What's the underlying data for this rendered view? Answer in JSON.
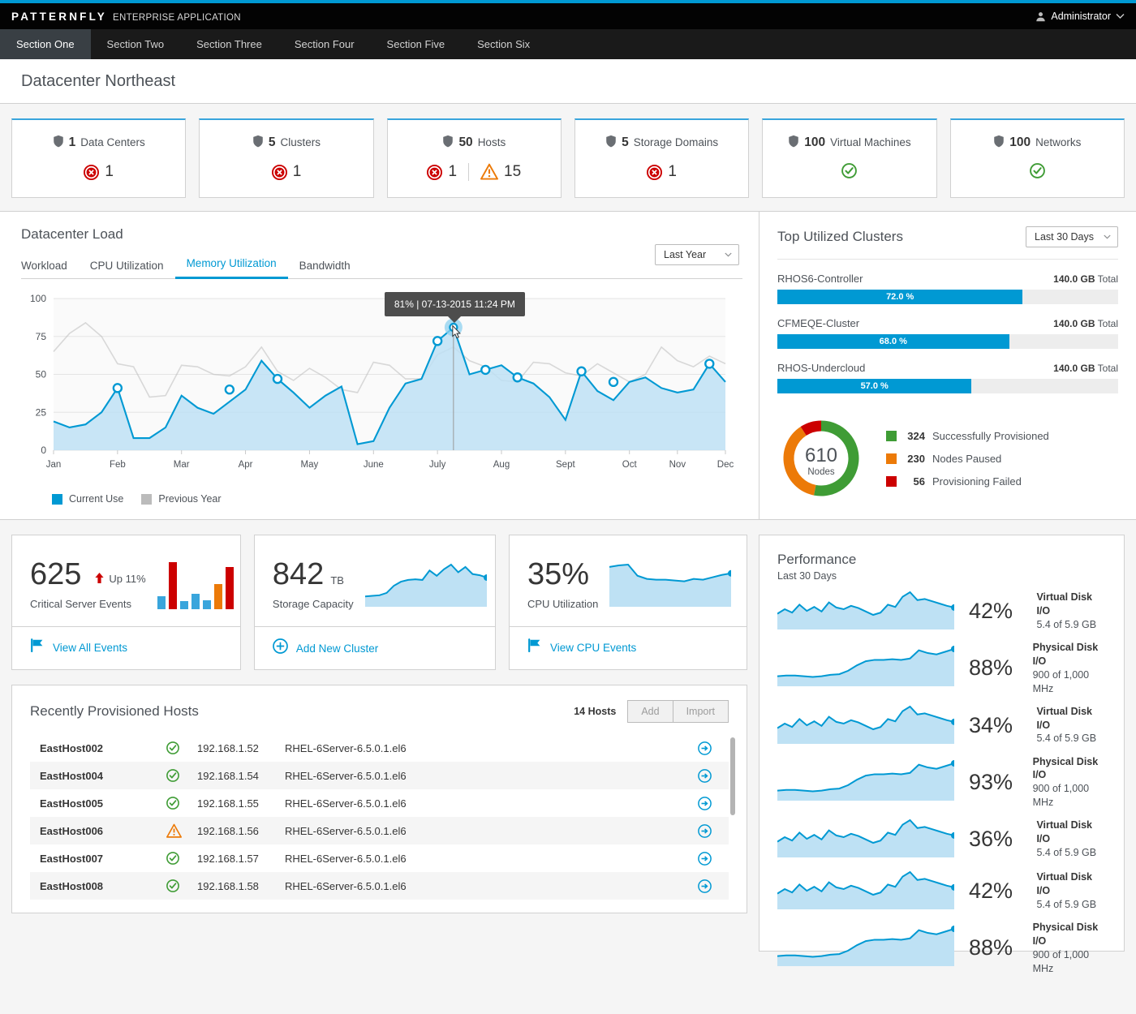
{
  "masthead": {
    "brand": "PATTERNFLY",
    "brand_sub": "ENTERPRISE APPLICATION",
    "user": "Administrator",
    "user_icon": "user-icon",
    "caret_icon": "chevron-down-icon"
  },
  "nav": {
    "items": [
      {
        "label": "Section One",
        "active": true
      },
      {
        "label": "Section Two",
        "active": false
      },
      {
        "label": "Section Three",
        "active": false
      },
      {
        "label": "Section Four",
        "active": false
      },
      {
        "label": "Section Five",
        "active": false
      },
      {
        "label": "Section Six",
        "active": false
      }
    ]
  },
  "page": {
    "title": "Datacenter Northeast"
  },
  "status_cards": [
    {
      "count": "1",
      "label": "Data Centers",
      "icon": "shield-icon",
      "statuses": [
        {
          "type": "error",
          "icon": "error-circle-icon",
          "value": "1"
        }
      ]
    },
    {
      "count": "5",
      "label": "Clusters",
      "icon": "shield-icon",
      "statuses": [
        {
          "type": "error",
          "icon": "error-circle-icon",
          "value": "1"
        }
      ]
    },
    {
      "count": "50",
      "label": "Hosts",
      "icon": "shield-icon",
      "statuses": [
        {
          "type": "error",
          "icon": "error-circle-icon",
          "value": "1"
        },
        {
          "type": "warning",
          "icon": "warning-triangle-icon",
          "value": "15"
        }
      ]
    },
    {
      "count": "5",
      "label": "Storage Domains",
      "icon": "shield-icon",
      "statuses": [
        {
          "type": "error",
          "icon": "error-circle-icon",
          "value": "1"
        }
      ]
    },
    {
      "count": "100",
      "label": "Virtual Machines",
      "icon": "shield-icon",
      "statuses": [
        {
          "type": "ok",
          "icon": "check-circle-icon",
          "value": ""
        }
      ]
    },
    {
      "count": "100",
      "label": "Networks",
      "icon": "shield-icon",
      "statuses": [
        {
          "type": "ok",
          "icon": "check-circle-icon",
          "value": ""
        }
      ]
    }
  ],
  "load_panel": {
    "title": "Datacenter Load",
    "tabs": [
      {
        "label": "Workload",
        "active": false
      },
      {
        "label": "CPU Utilization",
        "active": false
      },
      {
        "label": "Memory Utilization",
        "active": true
      },
      {
        "label": "Bandwidth",
        "active": false
      }
    ],
    "range_select": "Last Year",
    "tooltip": "81% | 07-13-2015 11:24 PM",
    "legend": [
      {
        "label": "Current Use",
        "color": "#0099d3"
      },
      {
        "label": "Previous Year",
        "color": "#bbbbbb"
      }
    ]
  },
  "chart_data": {
    "type": "area",
    "title": "Datacenter Load — Memory Utilization",
    "xlabel": "",
    "ylabel": "",
    "ylim": [
      0,
      100
    ],
    "yticks": [
      0,
      25,
      50,
      75,
      100
    ],
    "grid": true,
    "legend_position": "bottom-left",
    "categories": [
      "Jan",
      "Feb",
      "Mar",
      "Apr",
      "May",
      "June",
      "July",
      "Aug",
      "Sept",
      "Oct",
      "Nov",
      "Dec"
    ],
    "tick_labels": [
      "Jan",
      "Feb",
      "Mar",
      "Apr",
      "May",
      "June",
      "July",
      "Aug",
      "Sept",
      "Oct",
      "Nov",
      "Dec"
    ],
    "series": [
      {
        "name": "Current Use",
        "color": "#0099d3",
        "values": [
          19,
          15,
          17,
          25,
          41,
          8,
          8,
          15,
          36,
          28,
          24,
          32,
          40,
          59,
          47,
          38,
          28,
          36,
          42,
          4,
          6,
          28,
          44,
          47,
          72,
          81,
          50,
          53,
          56,
          48,
          44,
          35,
          20,
          52,
          39,
          33,
          45,
          48,
          41,
          38,
          40,
          57,
          45
        ],
        "markers": [
          {
            "index": 4,
            "value": 41
          },
          {
            "index": 11,
            "value": 40
          },
          {
            "index": 14,
            "value": 47
          },
          {
            "index": 24,
            "value": 72
          },
          {
            "index": 25,
            "value": 81,
            "highlighted": true
          },
          {
            "index": 27,
            "value": 53
          },
          {
            "index": 29,
            "value": 48
          },
          {
            "index": 33,
            "value": 52
          },
          {
            "index": 35,
            "value": 45
          },
          {
            "index": 41,
            "value": 57
          }
        ]
      },
      {
        "name": "Previous Year",
        "color": "#bbbbbb",
        "values": [
          65,
          77,
          84,
          75,
          57,
          55,
          35,
          36,
          56,
          55,
          50,
          49,
          55,
          68,
          52,
          46,
          54,
          48,
          40,
          38,
          58,
          56,
          47,
          47,
          63,
          68,
          59,
          55,
          46,
          45,
          58,
          57,
          51,
          49,
          57,
          51,
          45,
          50,
          68,
          59,
          55,
          62,
          57
        ]
      }
    ]
  },
  "clusters_panel": {
    "title": "Top Utilized Clusters",
    "range_select": "Last 30 Days",
    "clusters": [
      {
        "name": "RHOS6-Controller",
        "total": "140.0 GB",
        "total_suffix": "Total",
        "percent_label": "72.0 %",
        "percent": 72
      },
      {
        "name": "CFMEQE-Cluster",
        "total": "140.0 GB",
        "total_suffix": "Total",
        "percent_label": "68.0 %",
        "percent": 68
      },
      {
        "name": "RHOS-Undercloud",
        "total": "140.0 GB",
        "total_suffix": "Total",
        "percent_label": "57.0 %",
        "percent": 57
      }
    ],
    "donut": {
      "center_value": "610",
      "center_label": "Nodes",
      "segments": [
        {
          "value": "324",
          "label": "Successfully Provisioned",
          "color": "#3f9c35",
          "num": 324
        },
        {
          "value": "230",
          "label": "Nodes Paused",
          "color": "#ec7a08",
          "num": 230
        },
        {
          "value": "56",
          "label": "Provisioning Failed",
          "color": "#cc0000",
          "num": 56
        }
      ]
    }
  },
  "util_cards": [
    {
      "value": "625",
      "unit": "",
      "sub": "Critical Server Events",
      "trend": {
        "icon": "arrow-up-icon",
        "text": "Up 11%",
        "color": "#cc0000"
      },
      "spark_type": "bar",
      "bars": [
        {
          "h": 16,
          "color": "#39a5dc"
        },
        {
          "h": 58,
          "color": "#cc0000"
        },
        {
          "h": 10,
          "color": "#39a5dc"
        },
        {
          "h": 19,
          "color": "#39a5dc"
        },
        {
          "h": 11,
          "color": "#39a5dc"
        },
        {
          "h": 31,
          "color": "#ec7a08"
        },
        {
          "h": 52,
          "color": "#cc0000"
        }
      ],
      "footer": {
        "icon": "flag-icon",
        "label": "View All Events"
      }
    },
    {
      "value": "842",
      "unit": "TB",
      "sub": "Storage Capacity",
      "spark_type": "area",
      "spark": [
        12,
        13,
        14,
        18,
        30,
        37,
        40,
        41,
        40,
        56,
        47,
        58,
        66,
        53,
        62,
        50,
        48,
        44
      ],
      "footer": {
        "icon": "plus-circle-icon",
        "label": "Add New Cluster"
      }
    },
    {
      "value": "35%",
      "unit": "",
      "sub": "CPU Utilization",
      "spark_type": "area",
      "spark": [
        46,
        48,
        49,
        35,
        31,
        30,
        30,
        29,
        28,
        31,
        30,
        33,
        36,
        38
      ],
      "footer": {
        "icon": "flag-icon",
        "label": "View CPU Events"
      }
    }
  ],
  "hosts": {
    "title": "Recently Provisioned Hosts",
    "count_label": "14 Hosts",
    "buttons": [
      {
        "label": "Add"
      },
      {
        "label": "Import"
      }
    ],
    "rows": [
      {
        "name": "EastHost002",
        "status": "ok",
        "status_icon": "check-circle-icon",
        "ip": "192.168.1.52",
        "os": "RHEL-6Server-6.5.0.1.el6",
        "action_icon": "arrow-right-circle-icon"
      },
      {
        "name": "EastHost004",
        "status": "ok",
        "status_icon": "check-circle-icon",
        "ip": "192.168.1.54",
        "os": "RHEL-6Server-6.5.0.1.el6",
        "action_icon": "arrow-right-circle-icon"
      },
      {
        "name": "EastHost005",
        "status": "ok",
        "status_icon": "check-circle-icon",
        "ip": "192.168.1.55",
        "os": "RHEL-6Server-6.5.0.1.el6",
        "action_icon": "arrow-right-circle-icon"
      },
      {
        "name": "EastHost006",
        "status": "warning",
        "status_icon": "warning-triangle-icon",
        "ip": "192.168.1.56",
        "os": "RHEL-6Server-6.5.0.1.el6",
        "action_icon": "arrow-right-circle-icon"
      },
      {
        "name": "EastHost007",
        "status": "ok",
        "status_icon": "check-circle-icon",
        "ip": "192.168.1.57",
        "os": "RHEL-6Server-6.5.0.1.el6",
        "action_icon": "arrow-right-circle-icon"
      },
      {
        "name": "EastHost008",
        "status": "ok",
        "status_icon": "check-circle-icon",
        "ip": "192.168.1.58",
        "os": "RHEL-6Server-6.5.0.1.el6",
        "action_icon": "arrow-right-circle-icon"
      }
    ]
  },
  "performance": {
    "title": "Performance",
    "subtitle": "Last 30 Days",
    "rows": [
      {
        "percent": "42%",
        "label": "Virtual Disk I/O",
        "value": "5.4 of 5.9 GB",
        "spark_type": "jagged"
      },
      {
        "percent": "88%",
        "label": "Physical Disk I/O",
        "value": "900 of 1,000 MHz",
        "spark_type": "ramp"
      },
      {
        "percent": "34%",
        "label": "Virtual Disk I/O",
        "value": "5.4 of 5.9 GB",
        "spark_type": "jagged"
      },
      {
        "percent": "93%",
        "label": "Physical Disk I/O",
        "value": "900 of 1,000 MHz",
        "spark_type": "ramp"
      },
      {
        "percent": "36%",
        "label": "Virtual Disk I/O",
        "value": "5.4 of 5.9 GB",
        "spark_type": "jagged"
      },
      {
        "percent": "42%",
        "label": "Virtual Disk I/O",
        "value": "5.4 of 5.9 GB",
        "spark_type": "jagged"
      },
      {
        "percent": "88%",
        "label": "Physical Disk I/O",
        "value": "900 of 1,000 MHz",
        "spark_type": "ramp"
      }
    ]
  },
  "colors": {
    "accent": "#0099d3",
    "ok": "#3f9c35",
    "warning": "#ec7a08",
    "error": "#cc0000",
    "area_fill": "#bee1f4"
  }
}
